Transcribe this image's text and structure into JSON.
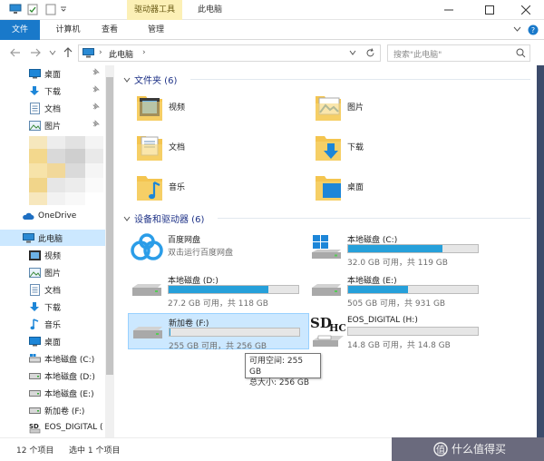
{
  "window": {
    "title": "此电脑",
    "context_tab": "驱动器工具",
    "controls": [
      "minimize-icon",
      "maximize-icon",
      "close-icon"
    ]
  },
  "ribbon": {
    "tabs": [
      "文件",
      "计算机",
      "查看",
      "管理"
    ]
  },
  "address": {
    "path_root": "›",
    "path": "此电脑",
    "path_sep": "›",
    "search_placeholder": "搜索\"此电脑\""
  },
  "nav": {
    "quick_access": [
      {
        "label": "桌面",
        "icon": "desktop-icon"
      },
      {
        "label": "下载",
        "icon": "download-icon"
      },
      {
        "label": "文档",
        "icon": "document-icon"
      },
      {
        "label": "图片",
        "icon": "picture-icon"
      }
    ],
    "onedrive": "OneDrive",
    "this_pc": "此电脑",
    "pc_items": [
      {
        "label": "视频",
        "icon": "video-icon"
      },
      {
        "label": "图片",
        "icon": "picture-icon"
      },
      {
        "label": "文档",
        "icon": "document-icon"
      },
      {
        "label": "下载",
        "icon": "download-icon"
      },
      {
        "label": "音乐",
        "icon": "music-icon"
      },
      {
        "label": "桌面",
        "icon": "desktop-icon"
      },
      {
        "label": "本地磁盘 (C:)",
        "icon": "drive-icon"
      },
      {
        "label": "本地磁盘 (D:)",
        "icon": "drive-icon"
      },
      {
        "label": "本地磁盘 (E:)",
        "icon": "drive-icon"
      },
      {
        "label": "新加卷 (F:)",
        "icon": "drive-icon"
      },
      {
        "label": "EOS_DIGITAL (",
        "icon": "sd-card-icon"
      }
    ]
  },
  "folders": {
    "header": "文件夹 (6)",
    "items": [
      {
        "label": "视频",
        "icon": "video-folder-icon"
      },
      {
        "label": "图片",
        "icon": "picture-folder-icon"
      },
      {
        "label": "文档",
        "icon": "document-folder-icon"
      },
      {
        "label": "下载",
        "icon": "download-folder-icon"
      },
      {
        "label": "音乐",
        "icon": "music-folder-icon"
      },
      {
        "label": "桌面",
        "icon": "desktop-folder-icon"
      }
    ]
  },
  "devices": {
    "header": "设备和驱动器 (6)",
    "items": [
      {
        "name": "百度网盘",
        "sub": "双击运行百度网盘",
        "icon": "baidu-netdisk-icon",
        "used": null
      },
      {
        "name": "本地磁盘 (C:)",
        "sub": "32.0 GB 可用，共 119 GB",
        "icon": "windows-drive-icon",
        "used": 0.73
      },
      {
        "name": "本地磁盘 (D:)",
        "sub": "27.2 GB 可用，共 118 GB",
        "icon": "drive-icon",
        "used": 0.77
      },
      {
        "name": "本地磁盘 (E:)",
        "sub": "505 GB 可用，共 931 GB",
        "icon": "drive-icon",
        "used": 0.46
      },
      {
        "name": "新加卷 (F:)",
        "sub": "255 GB 可用，共 256 GB",
        "icon": "drive-icon",
        "used": 0.004
      },
      {
        "name": "EOS_DIGITAL (H:)",
        "sub": "14.8 GB 可用，共 14.8 GB",
        "icon": "sd-card-icon",
        "used": 0.0
      }
    ]
  },
  "tooltip": {
    "line1": "可用空间: 255 GB",
    "line2": "总大小: 256 GB"
  },
  "status": {
    "count": "12 个项目",
    "selected": "选中 1 个项目"
  },
  "watermark": "什么值得买",
  "colors": {
    "accent": "#1979ca",
    "usage_bar": "#26a0da",
    "selection": "#cce8ff",
    "header_text": "#1e3287",
    "folder": "#f4c550"
  }
}
